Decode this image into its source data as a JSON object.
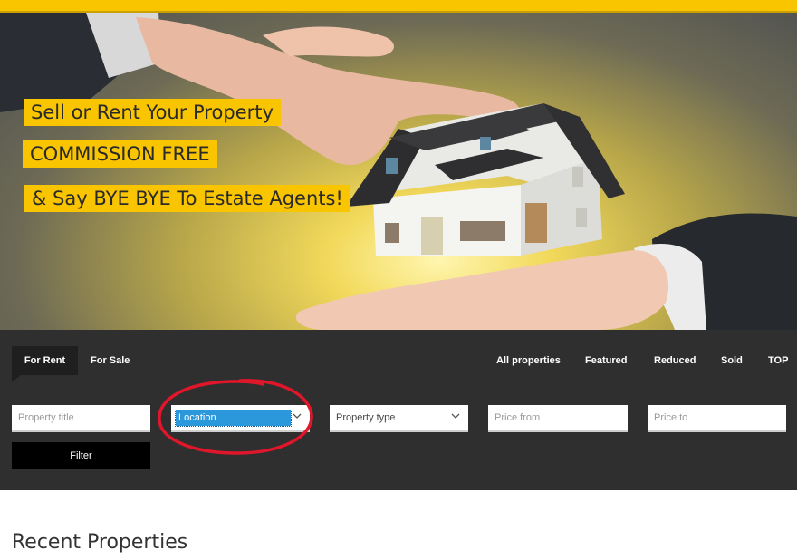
{
  "hero": {
    "taglines": [
      "Sell or Rent Your Property",
      "COMMISSION FREE",
      "& Say BYE BYE To Estate Agents!"
    ]
  },
  "search": {
    "tabs": [
      {
        "label": "For Rent",
        "active": true
      },
      {
        "label": "For Sale",
        "active": false
      }
    ],
    "filters": [
      "All properties",
      "Featured",
      "Reduced",
      "Sold",
      "TOP"
    ],
    "fields": {
      "title_placeholder": "Property title",
      "location_value": "Location",
      "type_value": "Property type",
      "price_from_placeholder": "Price from",
      "price_to_placeholder": "Price to"
    },
    "filter_button": "Filter"
  },
  "main": {
    "section_title": "Recent Properties"
  },
  "colors": {
    "accent": "#f9c400",
    "panel": "#2f2f2f",
    "selection": "#2b98dc",
    "annotation": "#e0162b"
  }
}
